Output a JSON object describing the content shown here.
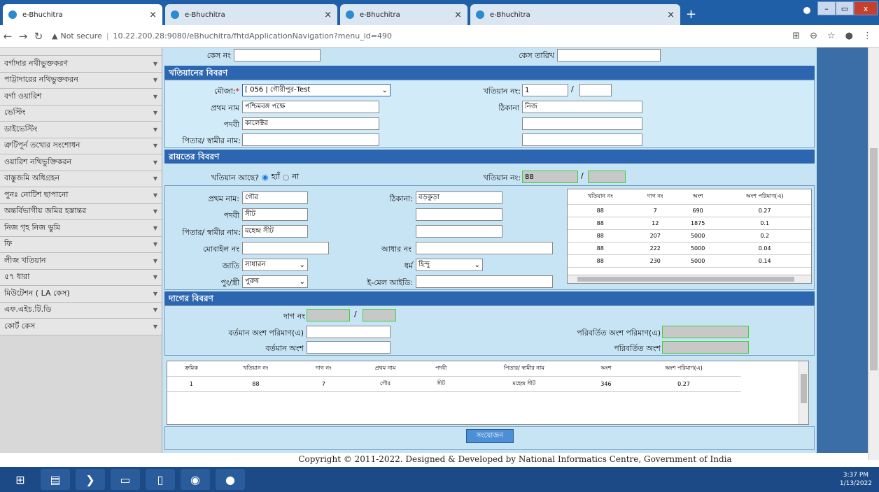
{
  "browser": {
    "tabs": [
      {
        "label": "e-Bhuchitra"
      },
      {
        "label": "e-Bhuchitra"
      },
      {
        "label": "e-Bhuchitra"
      },
      {
        "label": "e-Bhuchitra"
      }
    ],
    "not_secure": "Not secure",
    "url": "10.22.200.28:9080/eBhuchitra/fhtdApplicationNavigation?menu_id=490"
  },
  "sidebar": {
    "items": [
      "বর্গাদার নথীভুক্তকরণ",
      "পাট্টাদারের নথিভুক্তকরন",
      "বর্গা ওয়ারিশ",
      "ভেস্টিং",
      "ডাইভেস্টিং",
      "ত্রুটিপূর্ন তথ্যের সংশোধন",
      "ওয়ারিশ নথিভুক্তিকরন",
      "বাস্তুজমি অধিগ্রহন",
      "পুনঃ নোটিশ ছাপানো",
      "অন্তর্বিভাগীয় জমির হস্তান্তর",
      "নিজ গৃহ নিজ ভুমি",
      "ফি",
      "লীজ খতিয়ান",
      "৫৭ ধারা",
      "মিউটেশন ( LA কেস)",
      "এফ.এইচ.টি.ডি",
      "কোর্ট কেস"
    ]
  },
  "case": {
    "case_no_label": "কেস নং",
    "case_date_label": "কেস তারিখ"
  },
  "khatian_section": {
    "title": "খতিয়ানের বিবরণ",
    "mouja_label": "মৌজা:",
    "mouja_value": "[ 056 | গৌরীপুর-Test",
    "khatian_no_label": "খতিয়ান নং:",
    "khatian_no_value": "1",
    "first_name_label": "প্রথম নাম",
    "first_name_value": "পশ্চিমবঙ্গ পক্ষে",
    "address_label": "ঠিকানা",
    "address_value": "নিজ",
    "title_label": "পদবী",
    "title_value": "কালেক্টর",
    "father_label": "পিতার/ স্বামীর নাম:"
  },
  "raiyat_section": {
    "title": "রায়তের বিবরণ",
    "has_khatian_label": "খতিয়ান আছে?",
    "yes_label": "হ্যাঁ",
    "no_label": "না",
    "khatian_no_label": "খতিয়ান নং:",
    "khatian_no_value": "88",
    "first_name_label": "প্রথম নাম:",
    "first_name_value": "গৌর",
    "address_label": "ঠিকানা:",
    "address_value": "বড়কুড়া",
    "title_label": "পদবী",
    "title_value": "সীট",
    "father_label": "পিতার/ স্বামীর নাম:",
    "father_value": "মহেন্দ্র সীট",
    "mobile_label": "মোবাইল নং",
    "aadhar_label": "আধার নং",
    "caste_label": "জাতি",
    "caste_value": "সাধারন",
    "religion_label": "ধর্ম",
    "religion_value": "হিন্দু",
    "gender_label": "পুং/স্ত্রী",
    "gender_value": "পুরুষ",
    "email_label": "ই-মেল আইডি:",
    "grid": {
      "headers": [
        "খতিয়ান নং",
        "দাগ নং",
        "অংশ",
        "অংশ পরিমাণ(এ)"
      ],
      "rows": [
        [
          "88",
          "7",
          "690",
          "0.27"
        ],
        [
          "88",
          "12",
          "1875",
          "0.1"
        ],
        [
          "88",
          "207",
          "5000",
          "0.2"
        ],
        [
          "88",
          "222",
          "5000",
          "0.04"
        ],
        [
          "88",
          "230",
          "5000",
          "0.14"
        ]
      ]
    }
  },
  "dag_section": {
    "title": "দাগের বিবরণ",
    "dag_no_label": "দাগ নং",
    "current_area_label": "বর্তমান অংশ পরিমাণ(এ)",
    "changed_area_label": "পরিবর্তিত অংশ পরিমাণ(এ)",
    "current_share_label": "বর্তমান অংশ",
    "changed_share_label": "পরিবর্তিত অংশ"
  },
  "result_grid": {
    "headers": [
      "ক্রমিক",
      "খতিয়ান নং",
      "দাগ নং",
      "প্রথম নাম",
      "পদবী",
      "পিতার/ স্বামীর নাম",
      "অংশ",
      "অংশ পরিমাণ(এ)"
    ],
    "rows": [
      [
        "1",
        "88",
        "7",
        "গৌর",
        "সীট",
        "মহেন্দ্র সীট",
        "346",
        "0.27"
      ]
    ]
  },
  "submit_label": "সংযোজন",
  "footer": "Copyright © 2011-2022. Designed & Developed by National Informatics Centre, Government of India",
  "taskbar": {
    "time": "3:37 PM",
    "date": "1/13/2022"
  }
}
